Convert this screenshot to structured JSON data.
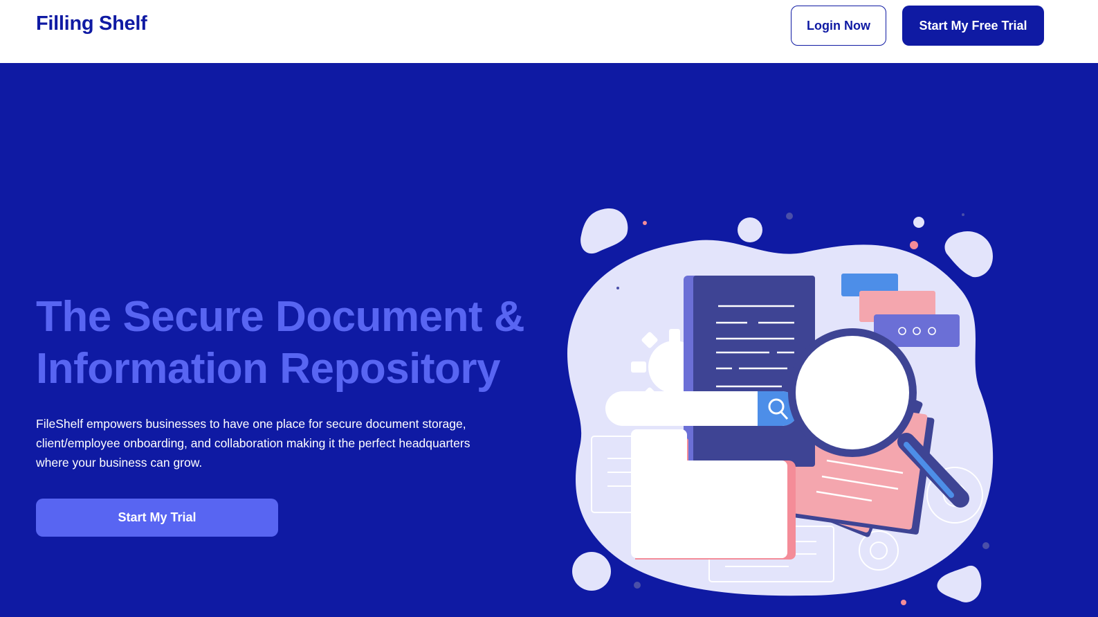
{
  "header": {
    "brand": "Filling Shelf",
    "login_label": "Login Now",
    "trial_label": "Start My Free Trial"
  },
  "hero": {
    "title": "The Secure Document & Information Repository",
    "description": "FileShelf empowers businesses to have one place for secure document storage, client/employee onboarding, and collaboration making it the perfect headquarters where your business can grow.",
    "cta_label": "Start My Trial"
  },
  "colors": {
    "brand_blue": "#0f1aa3",
    "accent": "#5865f2",
    "illustration_bg": "#e3e4fb",
    "document": "#3e4494",
    "pink": "#f4a6ae",
    "search_blue": "#4d8ee8"
  },
  "illustration": {
    "name": "document-search-illustration",
    "icons": [
      "search-icon",
      "document-icon",
      "folder-icon",
      "magnifier-icon",
      "gear-icon",
      "chat-bubble-icon"
    ]
  }
}
